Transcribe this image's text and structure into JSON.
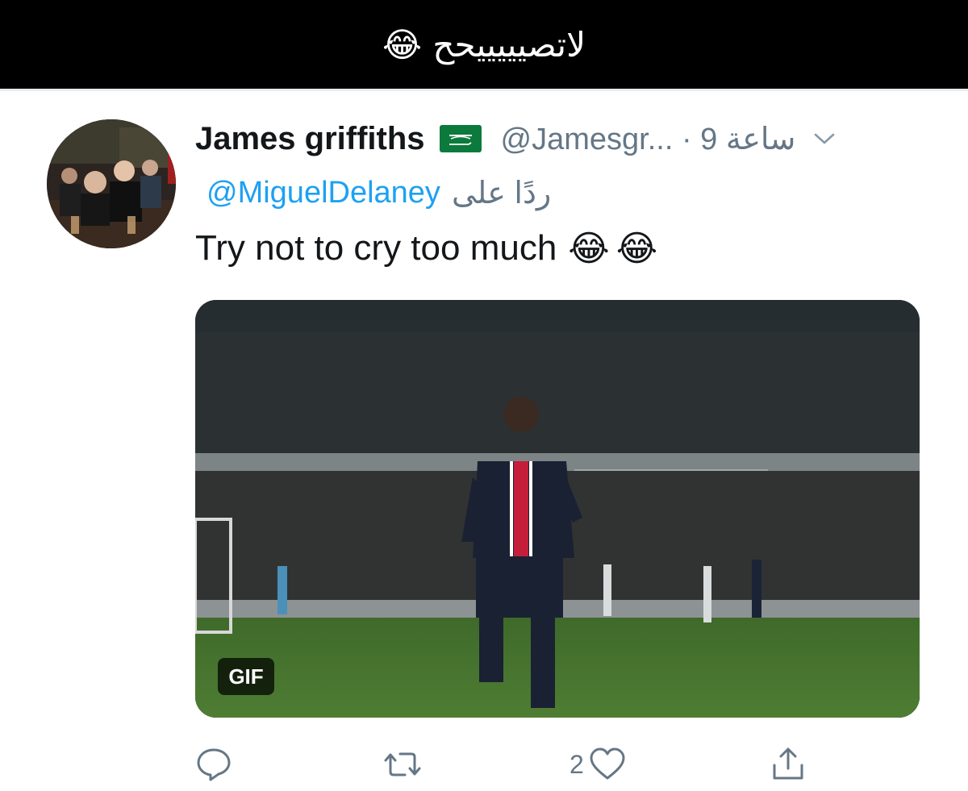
{
  "caption": {
    "text": "لاتصيييييحح 😂"
  },
  "tweet": {
    "display_name": "James griffiths",
    "handle_time": "@Jamesgr... · 9 ساعة",
    "reply_to_mention": "@MiguelDelaney",
    "reply_to_prefix": "ردًا على",
    "text": "Try not to cry too much",
    "text_emojis": "😂😂",
    "media": {
      "badge": "GIF"
    },
    "actions": {
      "like_count": "2"
    }
  },
  "colors": {
    "link_blue": "#1da1f2",
    "secondary_gray": "#657786",
    "caption_bar": "#000000"
  },
  "icons": {
    "reply": "reply-icon",
    "retweet": "retweet-icon",
    "like": "heart-icon",
    "share": "share-icon",
    "more": "chevron-down-icon",
    "flag": "saudi-flag-icon"
  }
}
